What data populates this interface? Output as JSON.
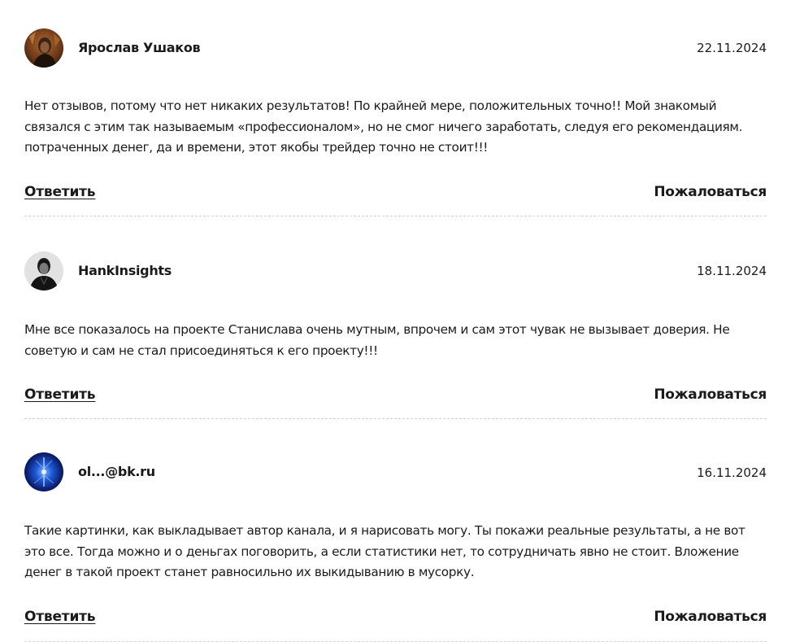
{
  "comments": [
    {
      "author": "Ярослав Ушаков",
      "date": "22.11.2024",
      "text": "Нет отзывов, потому что нет никаких результатов! По крайней мере, положительных точно!! Мой знакомый связался с этим так называемым «профессионалом», но не смог ничего заработать, следуя его рекомендациям. потраченных денег, да и времени, этот якобы трейдер точно не стоит!!!",
      "reply_label": "Ответить",
      "complain_label": "Пожаловаться",
      "avatar_icon": "user-photo-icon"
    },
    {
      "author": "HankInsights",
      "date": "18.11.2024",
      "text": "Мне все показалось на проекте Станислава очень мутным, впрочем и сам этот чувак не вызывает доверия. Не советую и сам не стал присоединяться к его проекту!!!",
      "reply_label": "Ответить",
      "complain_label": "Пожаловаться",
      "avatar_icon": "user-photo-icon"
    },
    {
      "author": "ol...@bk.ru",
      "date": "16.11.2024",
      "text": "Такие картинки, как выкладывает автор канала, и я нарисовать могу. Ты покажи реальные результаты, а не вот это все. Тогда можно и о деньгах поговорить, а если статистики нет, то сотрудничать явно не стоит. Вложение денег в такой проект станет равносильно их выкидыванию в мусорку.",
      "reply_label": "Ответить",
      "complain_label": "Пожаловаться",
      "avatar_icon": "user-photo-icon"
    }
  ],
  "colors": {
    "text": "#1b1b1b",
    "divider": "#d2d2d2",
    "background": "#ffffff"
  }
}
